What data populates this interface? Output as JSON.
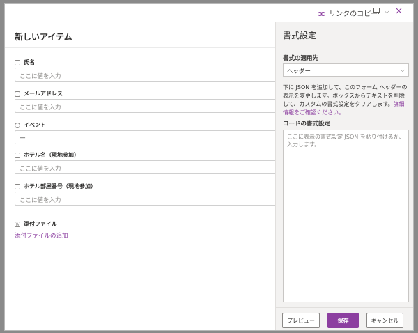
{
  "topbar": {
    "copy_link_label": "リンクのコピー",
    "link_icon": "link-icon",
    "comment_icon": "comment-icon",
    "chevron_icon": "chevron-down-icon",
    "close_icon": "close-icon"
  },
  "form": {
    "title": "新しいアイテム",
    "fields": [
      {
        "label": "氏名",
        "icon": "text-field-icon",
        "value": "",
        "placeholder": "ここに値を入力"
      },
      {
        "label": "メールアドレス",
        "icon": "text-field-icon",
        "value": "",
        "placeholder": "ここに値を入力"
      },
      {
        "label": "イベント",
        "icon": "choice-field-icon",
        "value": "—",
        "placeholder": ""
      },
      {
        "label": "ホテル名（現地参加）",
        "icon": "text-field-icon",
        "value": "",
        "placeholder": "ここに値を入力"
      },
      {
        "label": "ホテル部屋番号（現地参加）",
        "icon": "text-field-icon",
        "value": "",
        "placeholder": "ここに値を入力"
      }
    ],
    "attachments": {
      "label": "添付ファイル",
      "icon": "paperclip-icon",
      "add_link": "添付ファイルの追加"
    }
  },
  "format_panel": {
    "title": "書式設定",
    "apply_to_label": "書式の適用先",
    "apply_to_value": "ヘッダー",
    "description": "下に JSON を追加して、このフォーム ヘッダーの表示を変更します。ボックスからテキストを削除して、カスタムの書式設定をクリアします。",
    "more_info_link": "詳細情報をご確認ください。",
    "code_label": "コードの書式設定",
    "code_placeholder": "ここに表示の書式設定 JSON を貼り付けるか、入力します。",
    "buttons": {
      "preview": "プレビュー",
      "save": "保存",
      "cancel": "キャンセル"
    }
  },
  "colors": {
    "accent": "#8c3fa0",
    "panel_bg": "#f3f2f1"
  }
}
